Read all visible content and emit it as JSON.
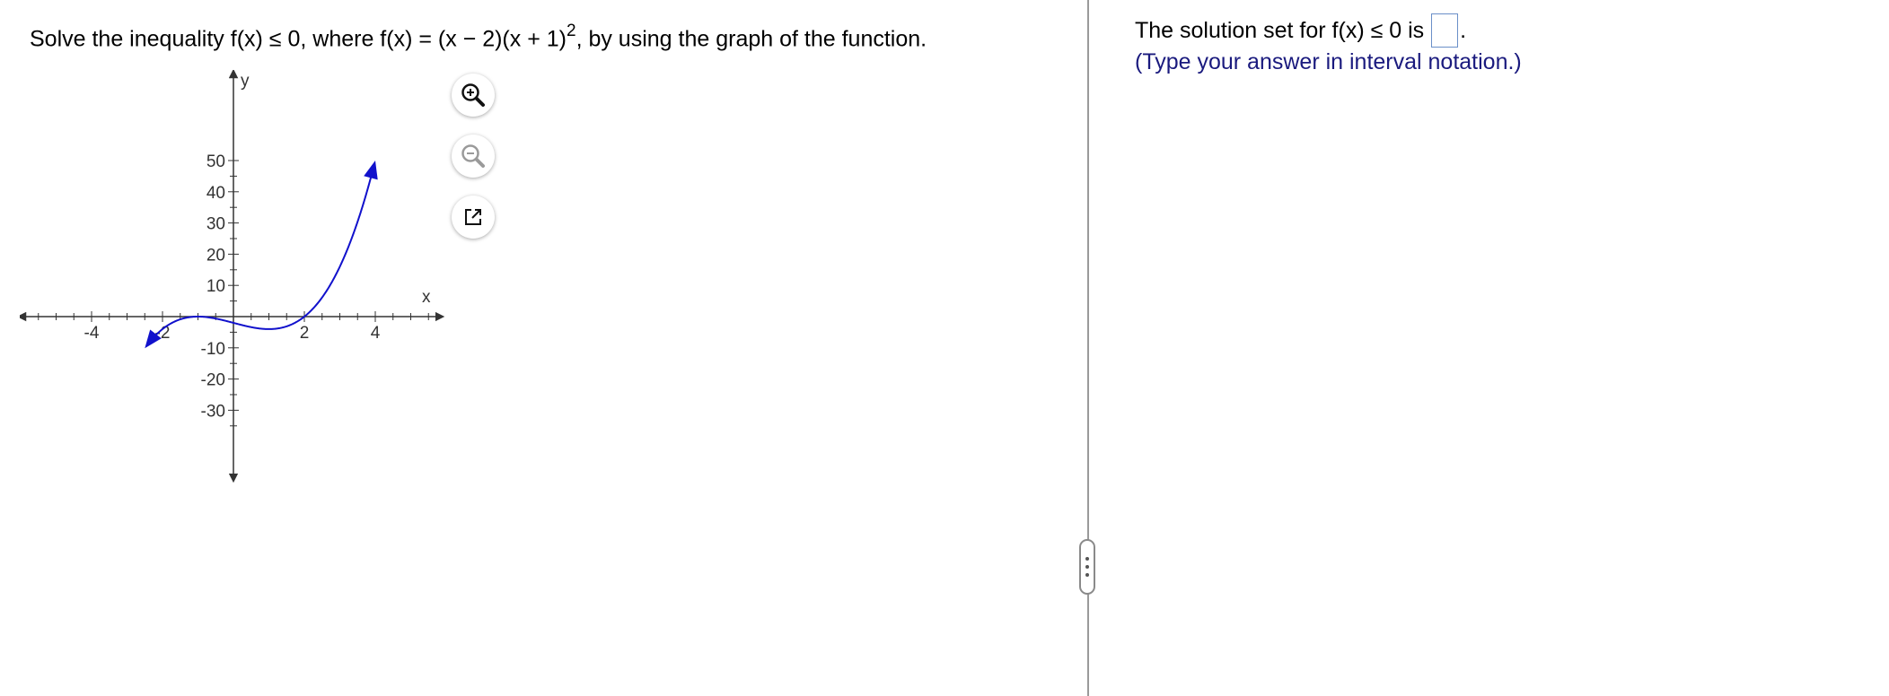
{
  "question": {
    "prefix": "Solve the inequality f(x) ≤ 0, where f(x) = (x − 2)(x + 1)",
    "exponent": "2",
    "suffix": ", by using the graph of the function."
  },
  "graph": {
    "y_axis_label": "y",
    "x_axis_label": "x",
    "x_ticks": [
      "-4",
      "-2",
      "2",
      "4"
    ],
    "y_ticks": [
      "50",
      "40",
      "30",
      "20",
      "10",
      "-10",
      "-20",
      "-30"
    ],
    "x_range": [
      -6,
      6
    ],
    "y_range": [
      -40,
      55
    ],
    "curve_color": "#1111cc",
    "axis_color": "#333333"
  },
  "tools": {
    "zoom_in": "zoom-in-icon",
    "zoom_out": "zoom-out-icon",
    "popout": "popout-icon"
  },
  "answer": {
    "prompt": "The solution set for f(x) ≤ 0 is",
    "trailing": ".",
    "input_value": "",
    "hint": "(Type your answer in interval notation.)"
  }
}
